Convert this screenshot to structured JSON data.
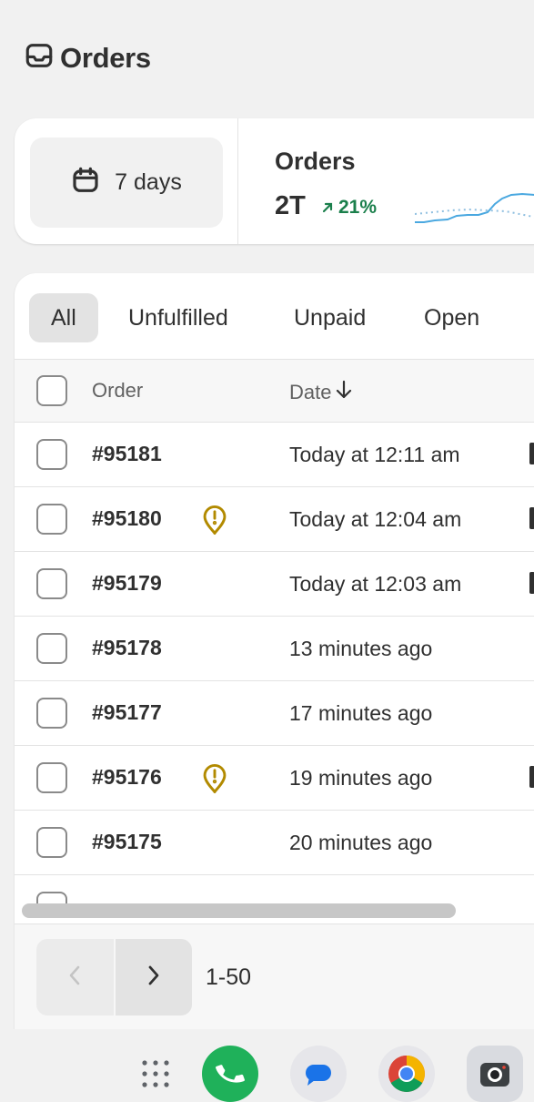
{
  "header": {
    "title": "Orders",
    "icon": "inbox-icon"
  },
  "stats": {
    "range_label": "7 days",
    "range_icon": "calendar-icon",
    "metric_title": "Orders",
    "metric_value": "2T",
    "metric_change": "21%",
    "change_color": "#1a7f4b",
    "sparkline_color": "#4aa8e0"
  },
  "tabs": [
    {
      "label": "All",
      "active": true
    },
    {
      "label": "Unfulfilled",
      "active": false
    },
    {
      "label": "Unpaid",
      "active": false
    },
    {
      "label": "Open",
      "active": false
    }
  ],
  "table": {
    "columns": {
      "order": "Order",
      "date": "Date"
    },
    "rows": [
      {
        "order": "#95181",
        "date": "Today at 12:11 am",
        "alert": false
      },
      {
        "order": "#95180",
        "date": "Today at 12:04 am",
        "alert": true
      },
      {
        "order": "#95179",
        "date": "Today at 12:03 am",
        "alert": false
      },
      {
        "order": "#95178",
        "date": "13 minutes ago",
        "alert": false
      },
      {
        "order": "#95177",
        "date": "17 minutes ago",
        "alert": false
      },
      {
        "order": "#95176",
        "date": "19 minutes ago",
        "alert": true
      },
      {
        "order": "#95175",
        "date": "20 minutes ago",
        "alert": false
      }
    ],
    "alert_color": "#b28a00"
  },
  "pagination": {
    "range": "1-50"
  },
  "dock": {
    "items": [
      {
        "name": "app-drawer-icon",
        "bg": "transparent"
      },
      {
        "name": "phone-app-icon",
        "bg": "#1fb15a"
      },
      {
        "name": "messages-app-icon",
        "bg": "#e6e6ea"
      },
      {
        "name": "chrome-app-icon",
        "bg": "#e6e6ea"
      },
      {
        "name": "camera-app-icon",
        "bg": "#d9dbe0"
      }
    ]
  }
}
